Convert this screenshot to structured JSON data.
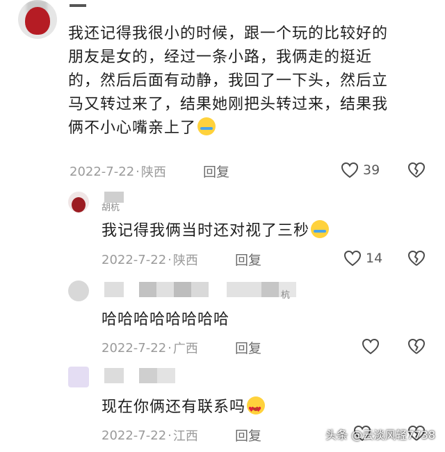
{
  "comments": [
    {
      "text_lines": [
        "我还记得我很小的时候，跟一个玩的比较好的",
        "朋友是女的，经过一条小路，我俩走的挺近",
        "的，然后后面有动静，我回了一下头，然后立",
        "马又转过来了，结果她刚把头转过来，结果我",
        "俩不小心嘴亲上了"
      ],
      "emoji": "loudly-crying-face",
      "date": "2022-7-22",
      "sep": "·",
      "location": "陕西",
      "reply_label": "回复",
      "likes": "39"
    },
    {
      "name_fragment": "胡杭",
      "text": "我记得我俩当时还对视了三秒",
      "emoji": "loudly-crying-face",
      "date": "2022-7-22",
      "sep": "·",
      "location": "陕西",
      "reply_label": "回复",
      "likes": "14"
    },
    {
      "name_fragment": "杭",
      "text": "哈哈哈哈哈哈哈哈",
      "date": "2022-7-22",
      "sep": "·",
      "location": "广西",
      "reply_label": "回复",
      "likes": ""
    },
    {
      "text": "现在你俩还有联系吗",
      "emoji": "smiling-face-with-heart-eyes",
      "date": "2022-7-22",
      "sep": "·",
      "location": "江西",
      "reply_label": "回复",
      "likes": ""
    }
  ],
  "watermark": "头条 @云淡风轻7738"
}
